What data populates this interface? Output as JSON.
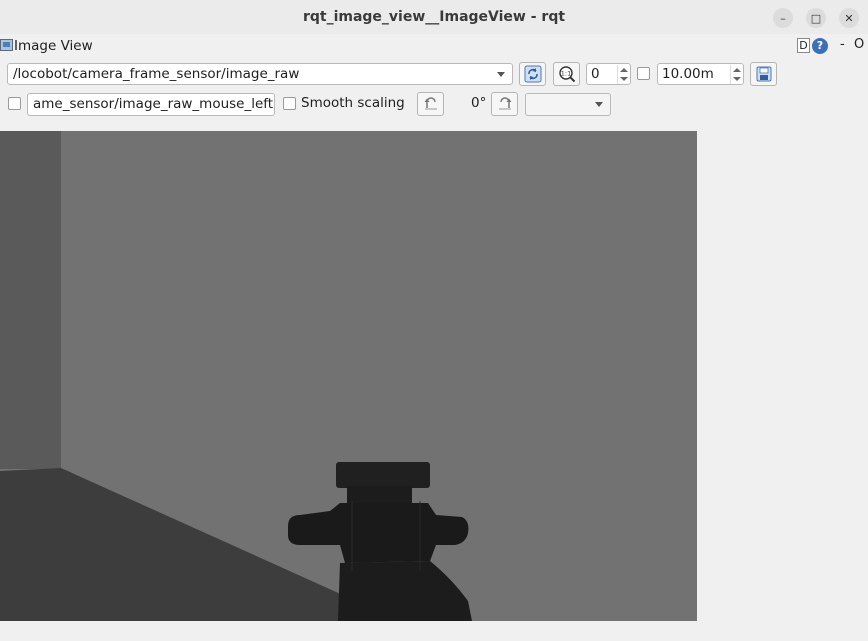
{
  "window": {
    "title": "rqt_image_view__ImageView - rqt",
    "minimize_icon": "minimize-icon",
    "maximize_icon": "maximize-icon",
    "close_icon": "close-icon"
  },
  "plugin": {
    "title": "Image View",
    "icon": "image-view-icon",
    "d_label": "D",
    "help_label": "?",
    "dash_label": "-",
    "o_label": "O"
  },
  "toolbar": {
    "topic": "/locobot/camera_frame_sensor/image_raw",
    "refresh_icon": "refresh-icon",
    "zoom_icon": "zoom-1-icon",
    "spin_value": "0",
    "max_value": "10.00m",
    "save_icon": "save-icon"
  },
  "toolbar2": {
    "mouse_topic": "ame_sensor/image_raw_mouse_left",
    "smooth_scaling_label": "Smooth scaling",
    "smooth_scaling_checked": false,
    "rotate_left_icon": "rotate-left-icon",
    "rotation": "0°",
    "rotate_right_icon": "rotate-right-icon",
    "rotation_select": ""
  },
  "colors": {
    "image_background": "#727272",
    "floor": "#3a3a3a",
    "left_wall": "#555555",
    "robot": "#1e1e1e"
  }
}
